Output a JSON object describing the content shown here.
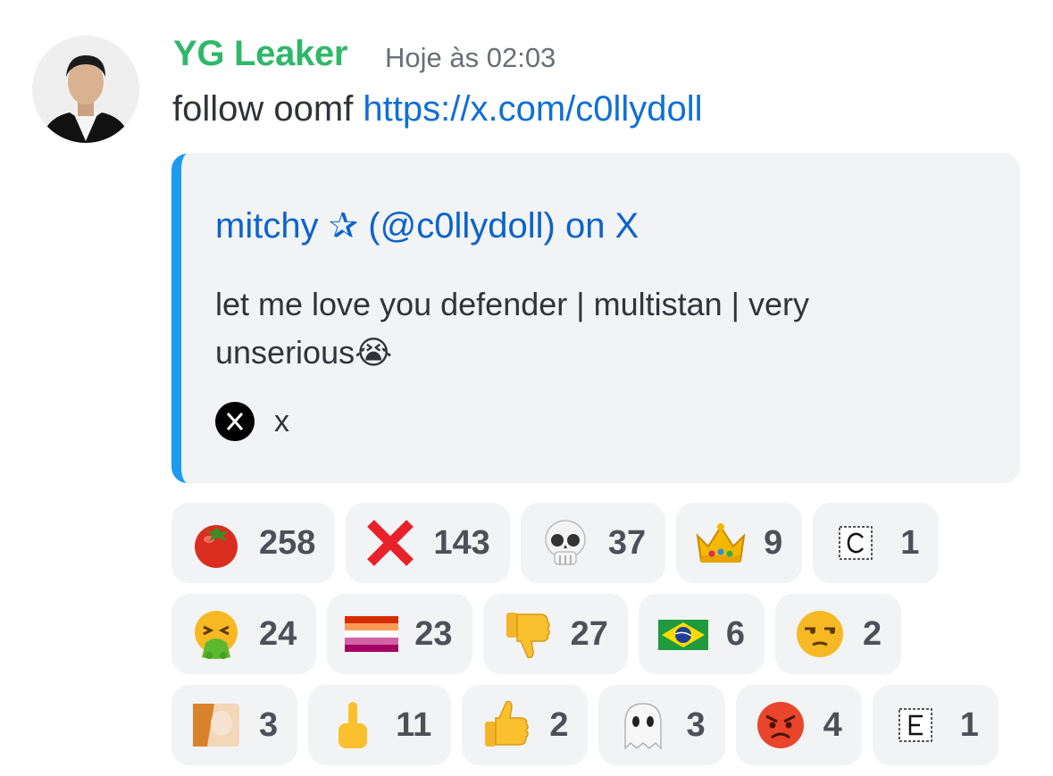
{
  "message": {
    "author": "YG Leaker",
    "timestamp": "Hoje às 02:03",
    "text": "follow oomf ",
    "link": "https://x.com/c0llydoll"
  },
  "embed": {
    "accent_color": "#1d9bf0",
    "title": "mitchy ✰ (@c0llydoll) on X",
    "description": "let me love you defender | multistan | very unserious😭",
    "footer": "x",
    "footer_icon": "x-logo-icon"
  },
  "reactions": {
    "row1": [
      {
        "emoji": "tomato",
        "count": "258"
      },
      {
        "emoji": "cross-mark",
        "count": "143"
      },
      {
        "emoji": "skull",
        "count": "37"
      },
      {
        "emoji": "crown",
        "count": "9"
      },
      {
        "emoji": "custom-c-emoji",
        "count": "1"
      }
    ],
    "row2": [
      {
        "emoji": "vomiting-face",
        "count": "24"
      },
      {
        "emoji": "lesbian-flag",
        "count": "23"
      },
      {
        "emoji": "thumbs-down",
        "count": "27"
      },
      {
        "emoji": "brazil-flag",
        "count": "6"
      },
      {
        "emoji": "unamused-face",
        "count": "2"
      }
    ],
    "row3": [
      {
        "emoji": "custom-image-emoji",
        "count": "3"
      },
      {
        "emoji": "middle-finger",
        "count": "11"
      },
      {
        "emoji": "thumbs-up",
        "count": "2"
      },
      {
        "emoji": "ghost",
        "count": "3"
      },
      {
        "emoji": "angry-face",
        "count": "4"
      },
      {
        "emoji": "custom-e-emoji",
        "count": "1"
      }
    ]
  },
  "colors": {
    "username": "#2fb86a",
    "link": "#0f6fd6",
    "embed_bg": "#f2f3f5",
    "reaction_bg": "#f2f3f5"
  }
}
